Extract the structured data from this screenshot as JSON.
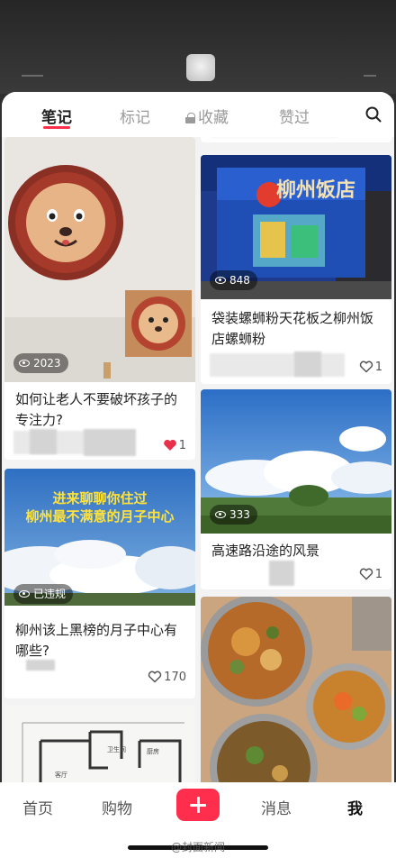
{
  "tabs": {
    "items": [
      {
        "label": "笔记",
        "active": true
      },
      {
        "label": "标记",
        "active": false
      },
      {
        "label": "收藏",
        "active": false,
        "icon": "lock-icon"
      },
      {
        "label": "赞过",
        "active": false
      }
    ],
    "search_icon": "search-icon"
  },
  "feed": {
    "left": [
      {
        "cover": "lion-wall-art",
        "views": "2023",
        "title_lines": [
          "如何让老人不要破坏孩子的",
          "专注力?"
        ],
        "likes": "1",
        "liked": true
      },
      {
        "cover": "clouds-sky-banner",
        "banner_lines": [
          "进来聊聊你住过",
          "柳州最不满意的月子中心"
        ],
        "status_badge": "已违规",
        "title_lines": [
          "柳州该上黑榜的月子中心有",
          "哪些?"
        ],
        "likes": "170",
        "liked": false
      },
      {
        "cover": "floor-plan",
        "floor_plan_labels": [
          "卫生间",
          "厨房",
          "客厅"
        ]
      }
    ],
    "right": [
      {
        "cover": "snail-noodle-box",
        "box_text": "柳州饭店",
        "views": "848",
        "title_lines": [
          "袋装螺蛳粉天花板之柳州饭",
          "店螺蛳粉"
        ],
        "likes": "1",
        "liked": false
      },
      {
        "cover": "highway-sky",
        "views": "333",
        "title_lines": [
          "高速路沿途的风景"
        ],
        "likes": "1",
        "liked": false
      },
      {
        "cover": "food-bowls"
      }
    ]
  },
  "bottom_nav": {
    "items": [
      {
        "label": "首页",
        "active": false
      },
      {
        "label": "购物",
        "active": false
      },
      {
        "label": "消息",
        "active": false
      },
      {
        "label": "我",
        "active": true
      }
    ],
    "plus_icon": "plus-icon"
  },
  "watermark": "@封面新闻",
  "colors": {
    "accent": "#ff2e4d",
    "feed_bg": "#f3f3f3",
    "text": "#222222",
    "muted": "#9a9a9a"
  }
}
